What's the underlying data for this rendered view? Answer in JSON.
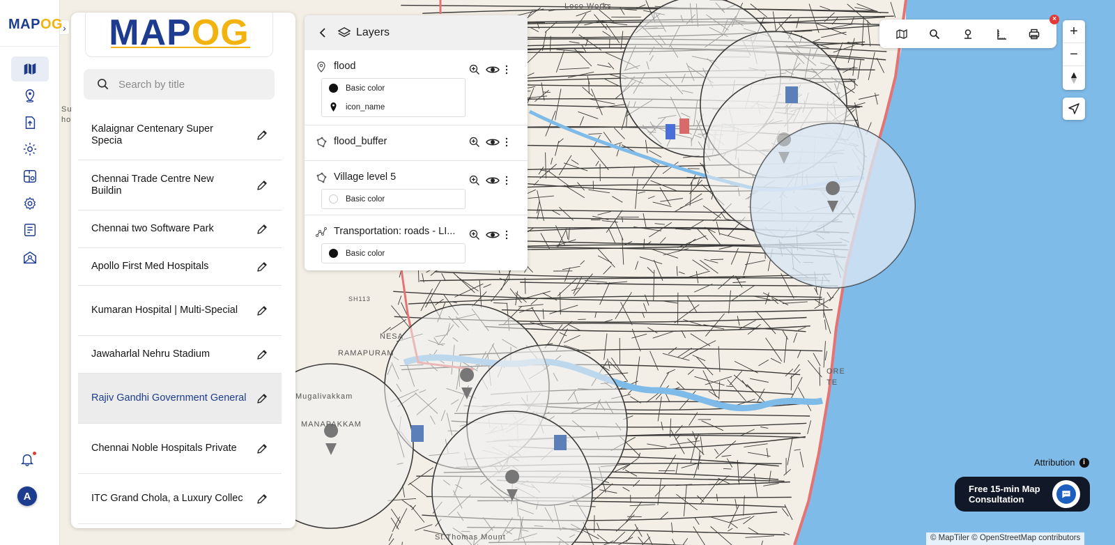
{
  "app": {
    "name": "MAPOG",
    "logo_main": "MAP",
    "logo_accent": "OG",
    "brand_color": "#1d3c8f",
    "accent_color": "#f2b30f"
  },
  "rail": {
    "expand_icon": "chevron-right-icon",
    "items": [
      {
        "icon": "map-icon",
        "active": true
      },
      {
        "icon": "location-pin-icon"
      },
      {
        "icon": "upload-file-icon"
      },
      {
        "icon": "settings-gear-icon"
      },
      {
        "icon": "map-analysis-icon"
      },
      {
        "icon": "cog-icon"
      },
      {
        "icon": "report-icon"
      },
      {
        "icon": "map-share-icon"
      }
    ],
    "avatar_letter": "A"
  },
  "title_panel": {
    "search_placeholder": "Search by title",
    "items": [
      {
        "title": "Kalaignar Centenary Super Specia"
      },
      {
        "title": "Chennai Trade Centre New Buildin"
      },
      {
        "title": "Chennai two Software Park"
      },
      {
        "title": "Apollo First Med Hospitals"
      },
      {
        "title": "Kumaran Hospital | Multi-Special"
      },
      {
        "title": "Jawaharlal Nehru Stadium"
      },
      {
        "title": "Rajiv Gandhi Government General",
        "selected": true
      },
      {
        "title": "Chennai Noble Hospitals Private"
      },
      {
        "title": "ITC Grand Chola, a Luxury Collec"
      }
    ]
  },
  "layers_panel": {
    "title": "Layers",
    "layers": [
      {
        "name": "flood",
        "icon": "location-pin-icon",
        "legend": [
          {
            "label": "Basic color",
            "color": "#111111",
            "shape": "circle"
          },
          {
            "label": "icon_name",
            "color": "#111111",
            "shape": "pin"
          }
        ]
      },
      {
        "name": "flood_buffer",
        "icon": "polygon-icon",
        "legend": []
      },
      {
        "name": "Village level 5",
        "icon": "polygon-icon",
        "legend": [
          {
            "label": "Basic color",
            "color": "#ffffff",
            "shape": "circle"
          }
        ]
      },
      {
        "name": "Transportation: roads - LI...",
        "icon": "line-icon",
        "legend": [
          {
            "label": "Basic color",
            "color": "#111111",
            "shape": "circle"
          }
        ]
      }
    ]
  },
  "toolbar": {
    "tools": [
      "map-layers-icon",
      "search-icon",
      "pin-drop-icon",
      "measure-icon",
      "print-icon"
    ],
    "close_label": "×"
  },
  "zoom_controls": {
    "zoom_in": "+",
    "zoom_out": "−"
  },
  "map": {
    "water_color": "#7fbbe8",
    "labels": [
      "Su",
      "hoz",
      "NESA",
      "RAMAPURAM",
      "Mugalivakkam",
      "MANAPAKKAM",
      "SH113",
      "St.Thomas Mount",
      "ORE",
      "TE",
      "Loco Works"
    ]
  },
  "attribution": {
    "label": "Attribution",
    "text": "© MapTiler © OpenStreetMap contributors"
  },
  "consult": {
    "line1": "Free 15-min Map",
    "line2": "Consultation"
  }
}
